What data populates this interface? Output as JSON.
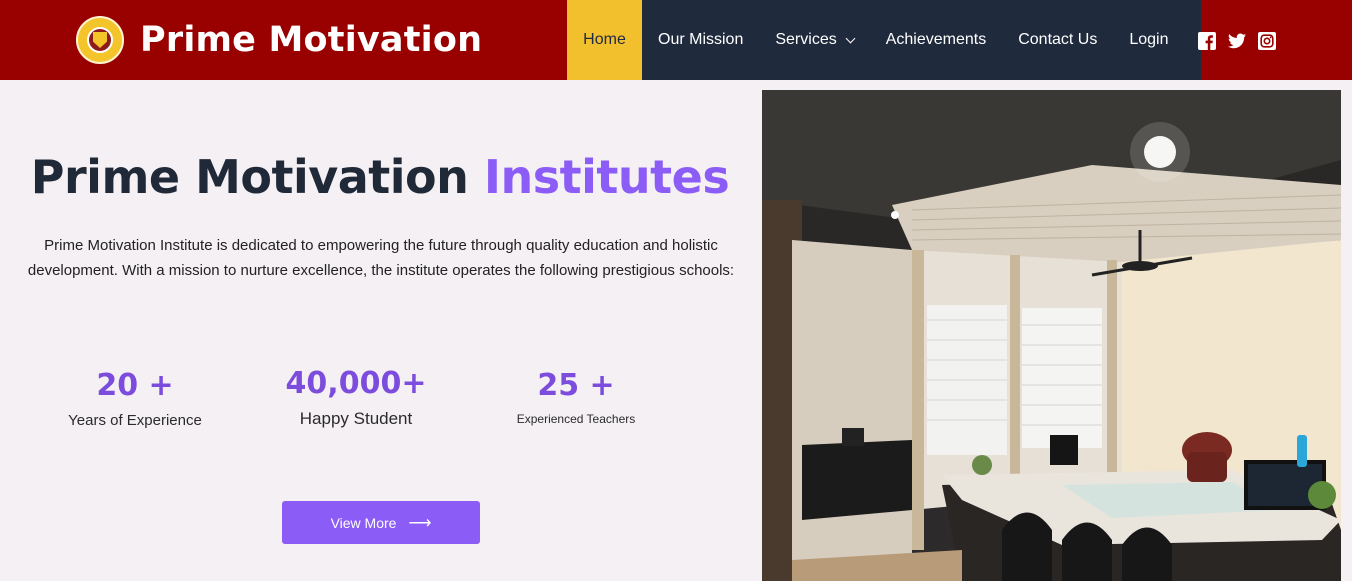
{
  "header": {
    "brand_name": "Prime Motivation",
    "nav": [
      {
        "label": "Home",
        "active": true
      },
      {
        "label": "Our Mission"
      },
      {
        "label": "Services",
        "has_dropdown": true
      },
      {
        "label": "Achievements"
      },
      {
        "label": "Contact Us"
      },
      {
        "label": "Login"
      }
    ],
    "social_icons": [
      "facebook-icon",
      "twitter-icon",
      "instagram-icon"
    ]
  },
  "hero": {
    "title_dark": "Prime Motivation",
    "title_accent": "Institutes",
    "description": "Prime Motivation Institute is dedicated to empowering the future through quality education and holistic development. With a mission to nurture excellence, the institute operates the following prestigious schools:",
    "stats": [
      {
        "value": "20 +",
        "label": "Years of Experience"
      },
      {
        "value": "40,000+",
        "label": "Happy Student"
      },
      {
        "value": "25 +",
        "label": "Experienced Teachers"
      }
    ],
    "cta_label": "View More"
  },
  "colors": {
    "header_bg": "#990000",
    "active_nav_bg": "#f2bf2d",
    "nav_bg": "#1f2a3d",
    "accent": "#8b5cf6",
    "page_bg": "#f4f0f4"
  }
}
